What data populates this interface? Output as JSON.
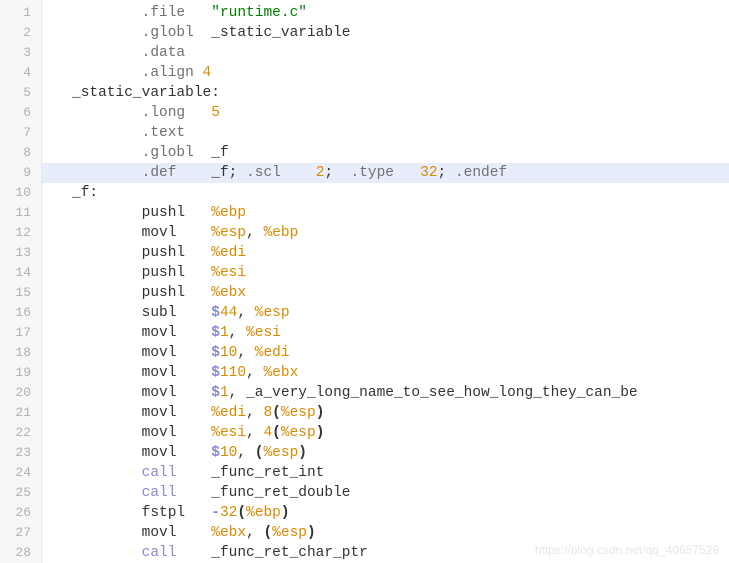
{
  "watermark": "https://blog.csdn.net/qq_40657528",
  "highlight_line": 9,
  "lines": [
    {
      "n": 1,
      "indent": 2,
      "tokens": [
        [
          "dir",
          ".file"
        ],
        [
          "gap",
          "   "
        ],
        [
          "str",
          "\"runtime.c\""
        ]
      ]
    },
    {
      "n": 2,
      "indent": 2,
      "tokens": [
        [
          "dir",
          ".globl"
        ],
        [
          "gap",
          "  "
        ],
        [
          "id",
          "_static_variable"
        ]
      ]
    },
    {
      "n": 3,
      "indent": 2,
      "tokens": [
        [
          "dir",
          ".data"
        ]
      ]
    },
    {
      "n": 4,
      "indent": 2,
      "tokens": [
        [
          "dir",
          ".align"
        ],
        [
          "gap",
          " "
        ],
        [
          "num",
          "4"
        ]
      ]
    },
    {
      "n": 5,
      "indent": 0,
      "tokens": [
        [
          "label",
          "_static_variable:"
        ]
      ]
    },
    {
      "n": 6,
      "indent": 2,
      "tokens": [
        [
          "dir",
          ".long"
        ],
        [
          "gap",
          "   "
        ],
        [
          "num",
          "5"
        ]
      ]
    },
    {
      "n": 7,
      "indent": 2,
      "tokens": [
        [
          "dir",
          ".text"
        ]
      ]
    },
    {
      "n": 8,
      "indent": 2,
      "tokens": [
        [
          "dir",
          ".globl"
        ],
        [
          "gap",
          "  "
        ],
        [
          "id",
          "_f"
        ]
      ]
    },
    {
      "n": 9,
      "indent": 2,
      "tokens": [
        [
          "dir",
          ".def"
        ],
        [
          "gap",
          "    "
        ],
        [
          "id",
          "_f"
        ],
        [
          "id",
          "; "
        ],
        [
          "dir",
          ".scl"
        ],
        [
          "gap",
          "    "
        ],
        [
          "num",
          "2"
        ],
        [
          "id",
          ";  "
        ],
        [
          "dir",
          ".type"
        ],
        [
          "gap",
          "   "
        ],
        [
          "num",
          "32"
        ],
        [
          "id",
          "; "
        ],
        [
          "dir",
          ".endef"
        ]
      ]
    },
    {
      "n": 10,
      "indent": 0,
      "tokens": [
        [
          "label",
          "_f:"
        ]
      ]
    },
    {
      "n": 11,
      "indent": 2,
      "tokens": [
        [
          "inst",
          "pushl"
        ],
        [
          "gap",
          "   "
        ],
        [
          "reg",
          "%ebp"
        ]
      ]
    },
    {
      "n": 12,
      "indent": 2,
      "tokens": [
        [
          "inst",
          "movl"
        ],
        [
          "gap",
          "    "
        ],
        [
          "reg",
          "%esp"
        ],
        [
          "id",
          ", "
        ],
        [
          "reg",
          "%ebp"
        ]
      ]
    },
    {
      "n": 13,
      "indent": 2,
      "tokens": [
        [
          "inst",
          "pushl"
        ],
        [
          "gap",
          "   "
        ],
        [
          "reg",
          "%edi"
        ]
      ]
    },
    {
      "n": 14,
      "indent": 2,
      "tokens": [
        [
          "inst",
          "pushl"
        ],
        [
          "gap",
          "   "
        ],
        [
          "reg",
          "%esi"
        ]
      ]
    },
    {
      "n": 15,
      "indent": 2,
      "tokens": [
        [
          "inst",
          "pushl"
        ],
        [
          "gap",
          "   "
        ],
        [
          "reg",
          "%ebx"
        ]
      ]
    },
    {
      "n": 16,
      "indent": 2,
      "tokens": [
        [
          "inst",
          "subl"
        ],
        [
          "gap",
          "    "
        ],
        [
          "imm",
          "$"
        ],
        [
          "immn",
          "44"
        ],
        [
          "id",
          ", "
        ],
        [
          "reg",
          "%esp"
        ]
      ]
    },
    {
      "n": 17,
      "indent": 2,
      "tokens": [
        [
          "inst",
          "movl"
        ],
        [
          "gap",
          "    "
        ],
        [
          "imm",
          "$"
        ],
        [
          "immn",
          "1"
        ],
        [
          "id",
          ", "
        ],
        [
          "reg",
          "%esi"
        ]
      ]
    },
    {
      "n": 18,
      "indent": 2,
      "tokens": [
        [
          "inst",
          "movl"
        ],
        [
          "gap",
          "    "
        ],
        [
          "imm",
          "$"
        ],
        [
          "immn",
          "10"
        ],
        [
          "id",
          ", "
        ],
        [
          "reg",
          "%edi"
        ]
      ]
    },
    {
      "n": 19,
      "indent": 2,
      "tokens": [
        [
          "inst",
          "movl"
        ],
        [
          "gap",
          "    "
        ],
        [
          "imm",
          "$"
        ],
        [
          "immn",
          "110"
        ],
        [
          "id",
          ", "
        ],
        [
          "reg",
          "%ebx"
        ]
      ]
    },
    {
      "n": 20,
      "indent": 2,
      "tokens": [
        [
          "inst",
          "movl"
        ],
        [
          "gap",
          "    "
        ],
        [
          "imm",
          "$"
        ],
        [
          "immn",
          "1"
        ],
        [
          "id",
          ", _a_very_long_name_to_see_how_long_they_can_be"
        ]
      ]
    },
    {
      "n": 21,
      "indent": 2,
      "tokens": [
        [
          "inst",
          "movl"
        ],
        [
          "gap",
          "    "
        ],
        [
          "reg",
          "%edi"
        ],
        [
          "id",
          ", "
        ],
        [
          "num",
          "8"
        ],
        [
          "paren",
          "("
        ],
        [
          "reg",
          "%esp"
        ],
        [
          "paren",
          ")"
        ]
      ]
    },
    {
      "n": 22,
      "indent": 2,
      "tokens": [
        [
          "inst",
          "movl"
        ],
        [
          "gap",
          "    "
        ],
        [
          "reg",
          "%esi"
        ],
        [
          "id",
          ", "
        ],
        [
          "num",
          "4"
        ],
        [
          "paren",
          "("
        ],
        [
          "reg",
          "%esp"
        ],
        [
          "paren",
          ")"
        ]
      ]
    },
    {
      "n": 23,
      "indent": 2,
      "tokens": [
        [
          "inst",
          "movl"
        ],
        [
          "gap",
          "    "
        ],
        [
          "imm",
          "$"
        ],
        [
          "immn",
          "10"
        ],
        [
          "id",
          ", "
        ],
        [
          "paren",
          "("
        ],
        [
          "reg",
          "%esp"
        ],
        [
          "paren",
          ")"
        ]
      ]
    },
    {
      "n": 24,
      "indent": 2,
      "tokens": [
        [
          "call",
          "call"
        ],
        [
          "gap",
          "    "
        ],
        [
          "id",
          "_func_ret_int"
        ]
      ]
    },
    {
      "n": 25,
      "indent": 2,
      "tokens": [
        [
          "call",
          "call"
        ],
        [
          "gap",
          "    "
        ],
        [
          "id",
          "_func_ret_double"
        ]
      ]
    },
    {
      "n": 26,
      "indent": 2,
      "tokens": [
        [
          "inst",
          "fstpl"
        ],
        [
          "gap",
          "   "
        ],
        [
          "imm",
          "-"
        ],
        [
          "immn",
          "32"
        ],
        [
          "paren",
          "("
        ],
        [
          "reg",
          "%ebp"
        ],
        [
          "paren",
          ")"
        ]
      ]
    },
    {
      "n": 27,
      "indent": 2,
      "tokens": [
        [
          "inst",
          "movl"
        ],
        [
          "gap",
          "    "
        ],
        [
          "reg",
          "%ebx"
        ],
        [
          "id",
          ", "
        ],
        [
          "paren",
          "("
        ],
        [
          "reg",
          "%esp"
        ],
        [
          "paren",
          ")"
        ]
      ]
    },
    {
      "n": 28,
      "indent": 2,
      "tokens": [
        [
          "call",
          "call"
        ],
        [
          "gap",
          "    "
        ],
        [
          "id",
          "_func_ret_char_ptr"
        ]
      ]
    }
  ]
}
